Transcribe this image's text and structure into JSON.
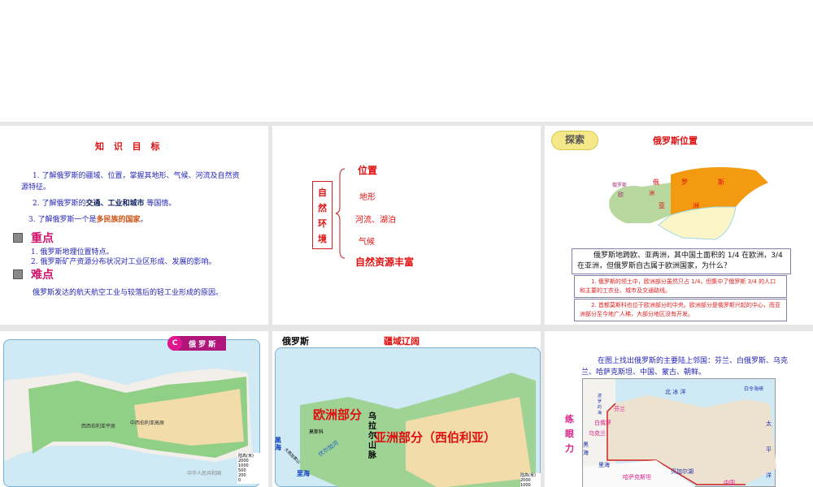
{
  "slide1": {
    "title": "知 识 目 标",
    "goal1": "1. 了解俄罗斯的疆域、位置，掌握其地形、气候、河流及自然资源特征。",
    "goal2_prefix": "2. 了解俄罗斯的",
    "goal2_bold": "交通、工业和城市",
    "goal2_suffix": " 等国情。",
    "goal3_prefix": "3. 了解俄罗斯一个是",
    "goal3_hl": "多民族的国家",
    "goal3_suffix": "。",
    "key_heading": "重点",
    "key1": "1. 俄罗斯地理位置特点。",
    "key2": "2. 俄罗斯矿产资源分布状况对工业区形成、发展的影响。",
    "diff_heading": "难点",
    "diff1": "俄罗斯发达的航天航空工业与较落后的轻工业形成的原因。"
  },
  "slide2": {
    "box": [
      "自",
      "然",
      "环",
      "境"
    ],
    "items": [
      "位置",
      "地形",
      "河流、湖泊",
      "气候",
      "自然资源丰富"
    ]
  },
  "slide3": {
    "badge": "探索",
    "title": "俄罗斯位置",
    "map_labels": [
      "俄",
      "罗",
      "斯",
      "俄",
      "洲",
      "亚",
      "洲",
      "欧",
      "俄罗斯"
    ],
    "question": "俄罗斯地跨欧、亚两洲，其中国土面积的 1/4 在欧洲，3/4 在亚洲，但俄罗斯自古属于欧洲国家，为什么？",
    "answer1": "1. 俄罗斯的领土中，欧洲部分虽然只占 1/4，但集中了俄罗斯 3/4 的人口和主要的工农业、城市及交通路线。",
    "answer2": "2. 首都莫斯科也位于欧洲部分的中央。欧洲部分是俄罗斯兴起的中心，而亚洲部分至今地广人稀，大部分地区没有开发。"
  },
  "slide4": {
    "badge_letter": "C",
    "badge_text": "俄 罗 斯",
    "legend_title": "陆高(米)",
    "legend_values": [
      "2000",
      "1000",
      "500",
      "200",
      "0"
    ],
    "labels": [
      "中西伯利亚高原",
      "西西伯利亚平原",
      "中华人民共和国"
    ]
  },
  "slide5": {
    "title": "俄罗斯",
    "subtitle": "疆域辽阔",
    "europe": "欧洲部分",
    "asia": "亚洲部分（西伯利亚）",
    "ural": "乌拉尔山脉",
    "moscow": "莫斯科",
    "volga": "伏尔加河",
    "black_sea": "黑海",
    "caspian": "里海",
    "caucasus": "大高加索山",
    "legend_title": "陆高(米)",
    "legend_values": [
      "2000",
      "1000"
    ]
  },
  "slide6": {
    "instruction": "在图上找出俄罗斯的主要陆上邻国：芬兰、白俄罗斯、乌克兰、哈萨克斯坦、中国、蒙古、朝鲜。",
    "side": [
      "练",
      "眼",
      "力"
    ],
    "labels": {
      "arctic": "北 冰 洋",
      "bering": "白令海峡",
      "pacific": [
        "太",
        "平",
        "洋"
      ],
      "finland": "芬兰",
      "belarus": "白俄罗",
      "ukraine": "乌克兰",
      "black_sea": "黑海",
      "caspian": "里海",
      "kazakhstan": "哈萨克斯坦",
      "baikal": "贝加尔湖",
      "china": "中国",
      "baltic": "波罗的海"
    }
  }
}
